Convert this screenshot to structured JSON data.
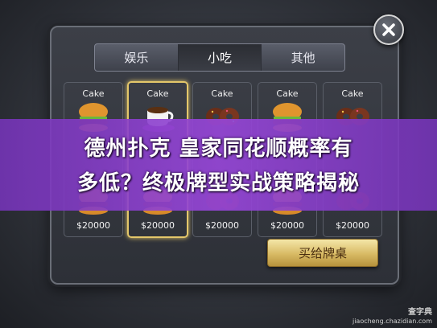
{
  "tabs": [
    {
      "label": "娱乐"
    },
    {
      "label": "小吃"
    },
    {
      "label": "其他"
    }
  ],
  "cards": [
    {
      "name": "Cake",
      "icon": "burger-icon",
      "price": "$20000"
    },
    {
      "name": "Cake",
      "icon": "coffee-icon",
      "price": "$20000"
    },
    {
      "name": "Cake",
      "icon": "donut-icon",
      "price": "$20000"
    },
    {
      "name": "Cake",
      "icon": "burger-icon",
      "price": "$20000"
    },
    {
      "name": "Cake",
      "icon": "donut-icon",
      "price": "$20000"
    }
  ],
  "buy_button": {
    "label": "买给牌桌"
  },
  "banner": {
    "line1": "德州扑克 皇家同花顺概率有",
    "line2": "多低？终极牌型实战策略揭秘"
  },
  "watermark": {
    "line1": "查字典",
    "line2": "jiaocheng.chazidian.com"
  }
}
